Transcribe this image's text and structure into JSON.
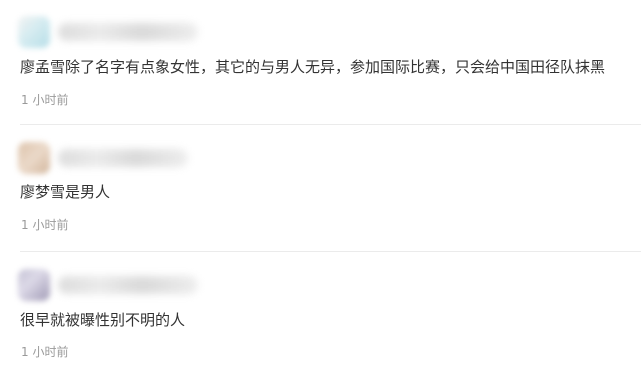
{
  "comments": [
    {
      "text": "廖孟雪除了名字有点象女性，其它的与男人无异，参加国际比赛，只会给中国田径队抹黑",
      "time": "1 小时前",
      "avatar_color": "#a9d8e3"
    },
    {
      "text": "廖梦雪是男人",
      "time": "1 小时前",
      "avatar_color": "#d6b89c"
    },
    {
      "text": "很早就被曝性别不明的人",
      "time": "1 小时前",
      "avatar_color": "#b9b6cc"
    }
  ],
  "colors": {
    "text": "#333333",
    "time": "#9a9a9a",
    "divider": "#ebebeb"
  }
}
